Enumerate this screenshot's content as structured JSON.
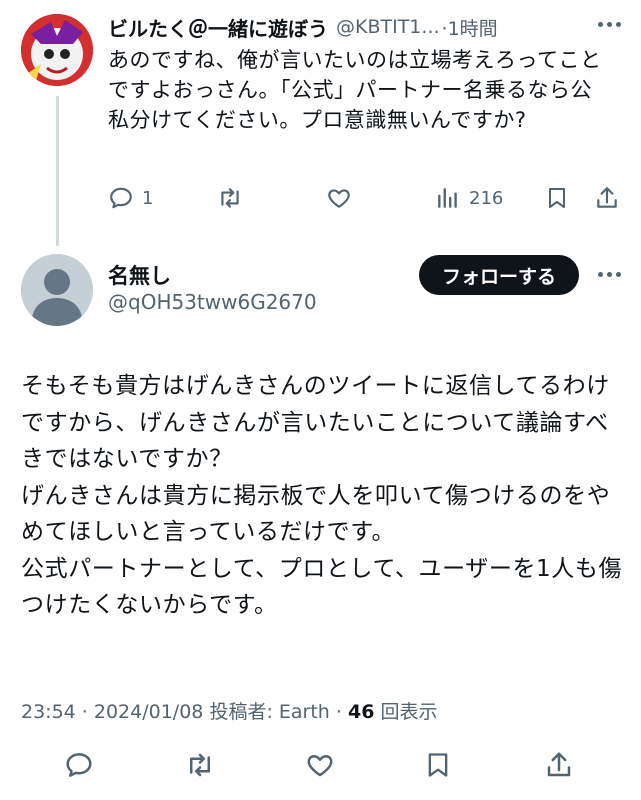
{
  "parent_tweet": {
    "display_name": "ビルたく＠一緒に遊ぼう",
    "handle": "@KBTIT1...",
    "time": "·1時間",
    "text": "あのですね、俺が言いたいのは立場考えろってことですよおっさん。「公式」パートナー名乗るなら公私分けてください。プロ意識無いんですか?",
    "actions": {
      "reply_count": "1",
      "retweet_count": "",
      "like_count": "",
      "views_count": "216"
    }
  },
  "main_tweet": {
    "display_name": "名無し",
    "handle": "@qOH53tww6G2670",
    "follow_label": "フォローする",
    "text": "そもそも貴方はげんきさんのツイートに返信してるわけですから、げんきさんが言いたいことについて議論すべきではないですか？\nげんきさんは貴方に掲示板で人を叩いて傷つけるのをやめてほしいと言っているだけです。\n公式パートナーとして、プロとして、ユーザーを1人も傷つけたくないからです。",
    "timestamp": "23:54 · 2024/01/08",
    "posted_by_label": "投稿者:",
    "posted_by": "Earth",
    "views": "46",
    "views_label": "回表示"
  },
  "colors": {
    "text_primary": "#0f1419",
    "text_secondary": "#536471",
    "thread_line": "#cfd9de",
    "follow_button_bg": "#0f1419",
    "avatar_default_bg": "#c4cfd6"
  },
  "icons": [
    "reply-icon",
    "retweet-icon",
    "like-icon",
    "views-icon",
    "bookmark-icon",
    "share-icon",
    "more-icon",
    "default-avatar-icon"
  ]
}
